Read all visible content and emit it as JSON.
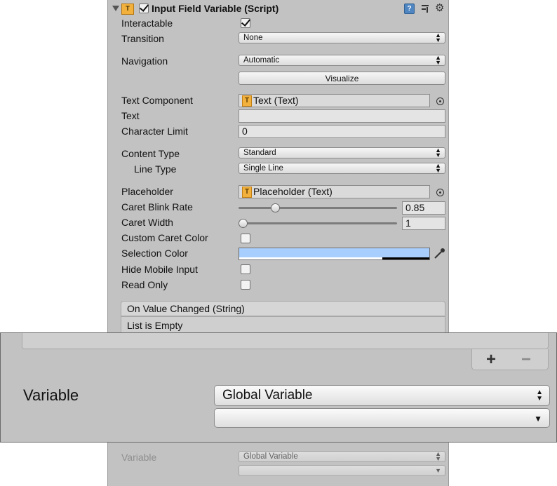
{
  "header": {
    "title": "Input Field Variable (Script)",
    "enabled": true
  },
  "fields": {
    "interactable_label": "Interactable",
    "interactable_checked": true,
    "transition_label": "Transition",
    "transition_value": "None",
    "navigation_label": "Navigation",
    "navigation_value": "Automatic",
    "visualize_label": "Visualize",
    "text_component_label": "Text Component",
    "text_component_value": "Text (Text)",
    "text_label": "Text",
    "text_value": "",
    "character_limit_label": "Character Limit",
    "character_limit_value": "0",
    "content_type_label": "Content Type",
    "content_type_value": "Standard",
    "line_type_label": "Line Type",
    "line_type_value": "Single Line",
    "placeholder_label": "Placeholder",
    "placeholder_value": "Placeholder (Text)",
    "caret_blink_rate_label": "Caret Blink Rate",
    "caret_blink_rate_value": "0.85",
    "caret_width_label": "Caret Width",
    "caret_width_value": "1",
    "custom_caret_color_label": "Custom Caret Color",
    "selection_color_label": "Selection Color",
    "hide_mobile_input_label": "Hide Mobile Input",
    "read_only_label": "Read Only"
  },
  "slider_levels": {
    "caret_blink_rate": 0.2125,
    "caret_width": 0.0
  },
  "event": {
    "header": "On Value Changed (String)",
    "empty_text": "List is Empty"
  },
  "zoom": {
    "variable_label": "Variable",
    "variable_value": "Global Variable",
    "second_value": ""
  },
  "faded": {
    "variable_label": "Variable",
    "variable_value": "Global Variable"
  },
  "colors": {
    "selection_color": "#a8cefe",
    "panel_bg": "#c2c2c2"
  },
  "icons": [
    "foldout-arrow-icon",
    "script-icon",
    "help-icon",
    "preset-icon",
    "gear-icon",
    "text-component-icon",
    "object-picker-icon",
    "eyedropper-icon",
    "plus-icon",
    "minus-icon"
  ]
}
